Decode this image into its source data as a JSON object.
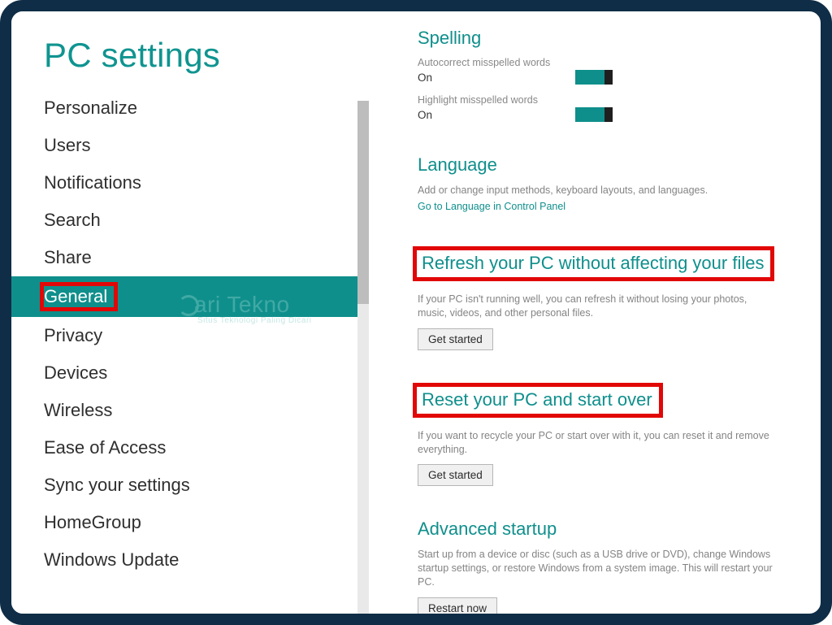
{
  "sidebar": {
    "title": "PC settings",
    "items": [
      {
        "label": "Personalize"
      },
      {
        "label": "Users"
      },
      {
        "label": "Notifications"
      },
      {
        "label": "Search"
      },
      {
        "label": "Share"
      },
      {
        "label": "General",
        "selected": true,
        "highlighted": true
      },
      {
        "label": "Privacy"
      },
      {
        "label": "Devices"
      },
      {
        "label": "Wireless"
      },
      {
        "label": "Ease of Access"
      },
      {
        "label": "Sync your settings"
      },
      {
        "label": "HomeGroup"
      },
      {
        "label": "Windows Update"
      }
    ]
  },
  "main": {
    "spelling": {
      "heading": "Spelling",
      "autocorrect_label": "Autocorrect misspelled words",
      "autocorrect_value": "On",
      "highlight_label": "Highlight misspelled words",
      "highlight_value": "On"
    },
    "language": {
      "heading": "Language",
      "desc": "Add or change input methods, keyboard layouts, and languages.",
      "link": "Go to Language in Control Panel"
    },
    "refresh": {
      "heading": "Refresh your PC without affecting your files",
      "desc": "If your PC isn't running well, you can refresh it without losing your photos, music, videos, and other personal files.",
      "button": "Get started"
    },
    "reset": {
      "heading": "Reset your PC and start over",
      "desc": "If you want to recycle your PC or start over with it, you can reset it and remove everything.",
      "button": "Get started"
    },
    "advanced": {
      "heading": "Advanced startup",
      "desc": "Start up from a device or disc (such as a USB drive or DVD), change Windows startup settings, or restore Windows from a system image. This will restart your PC.",
      "button": "Restart now"
    }
  },
  "watermark": {
    "main": "ari Tekno",
    "sub": "Situs Teknologi Paling Dicari"
  }
}
